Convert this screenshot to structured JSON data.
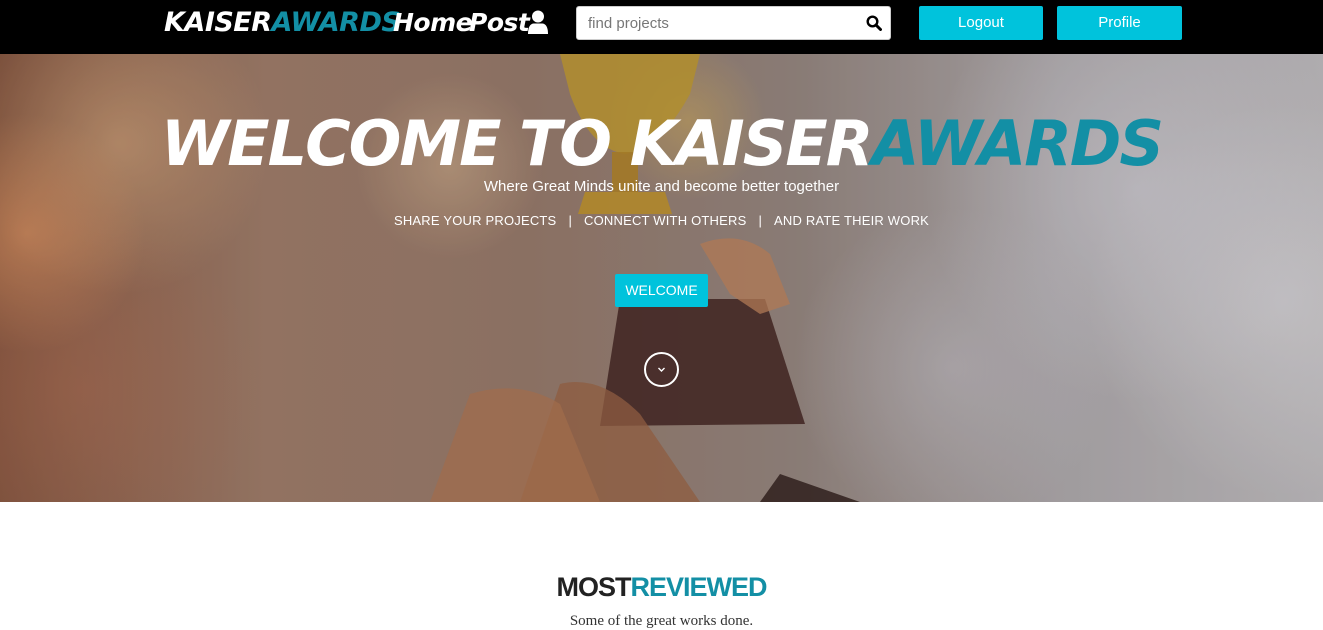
{
  "navbar": {
    "brand_part1": "KAISER",
    "brand_part2": "AWARDS",
    "home_label": "Home",
    "post_label": "Post",
    "user_icon": "user-icon",
    "search_placeholder": "find projects",
    "search_value": "",
    "search_icon": "search-icon",
    "logout_label": "Logout",
    "profile_label": "Profile"
  },
  "hero": {
    "title_part1": "WELCOME TO KAISER",
    "title_part2": "AWARDS",
    "subtitle": "Where Great Minds unite and become better together",
    "tags": [
      "SHARE YOUR PROJECTS",
      "CONNECT WITH OTHERS",
      "AND RATE THEIR WORK"
    ],
    "separator": "|",
    "welcome_label": "WELCOME",
    "scroll_icon": "chevron-down-icon"
  },
  "most_reviewed": {
    "title_part1": "MOST",
    "title_part2": "REVIEWED",
    "subtitle": "Some of the great works done."
  },
  "colors": {
    "navbar_bg": "#000000",
    "accent_teal": "#138fa5",
    "button_cyan": "#00c3dc",
    "text_white": "#ffffff"
  }
}
